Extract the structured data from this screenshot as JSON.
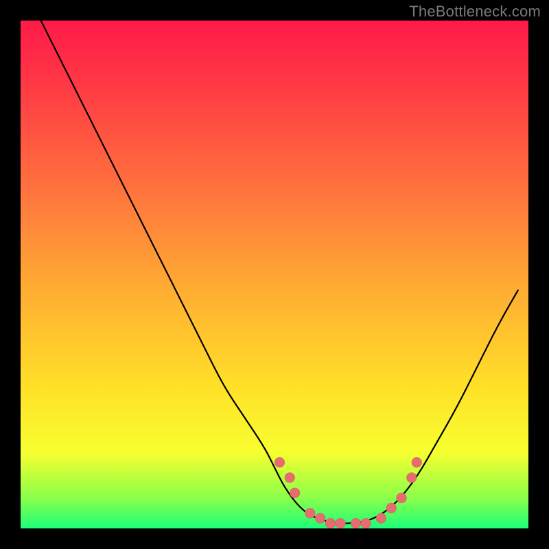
{
  "watermark": "TheBottleneck.com",
  "colors": {
    "frame_bg": "#000000",
    "gradient_top": "#ff1a49",
    "gradient_bottom": "#1cff79",
    "curve": "#000000",
    "marker": "#e86b6f"
  },
  "chart_data": {
    "type": "line",
    "title": "",
    "xlabel": "",
    "ylabel": "",
    "xlim": [
      0,
      100
    ],
    "ylim": [
      0,
      100
    ],
    "grid": false,
    "legend": false,
    "curve": [
      {
        "x": 4,
        "y": 100
      },
      {
        "x": 8,
        "y": 92
      },
      {
        "x": 12,
        "y": 84
      },
      {
        "x": 16,
        "y": 76
      },
      {
        "x": 20,
        "y": 68
      },
      {
        "x": 24,
        "y": 60
      },
      {
        "x": 28,
        "y": 52
      },
      {
        "x": 32,
        "y": 44
      },
      {
        "x": 36,
        "y": 36
      },
      {
        "x": 40,
        "y": 28
      },
      {
        "x": 44,
        "y": 22
      },
      {
        "x": 48,
        "y": 16
      },
      {
        "x": 50,
        "y": 12
      },
      {
        "x": 52,
        "y": 8
      },
      {
        "x": 55,
        "y": 4
      },
      {
        "x": 58,
        "y": 2
      },
      {
        "x": 62,
        "y": 1
      },
      {
        "x": 66,
        "y": 1
      },
      {
        "x": 70,
        "y": 2
      },
      {
        "x": 74,
        "y": 5
      },
      {
        "x": 78,
        "y": 10
      },
      {
        "x": 82,
        "y": 17
      },
      {
        "x": 86,
        "y": 24
      },
      {
        "x": 90,
        "y": 32
      },
      {
        "x": 94,
        "y": 40
      },
      {
        "x": 98,
        "y": 47
      }
    ],
    "markers": [
      {
        "x": 51,
        "y": 13
      },
      {
        "x": 53,
        "y": 10
      },
      {
        "x": 54,
        "y": 7
      },
      {
        "x": 57,
        "y": 3
      },
      {
        "x": 59,
        "y": 2
      },
      {
        "x": 61,
        "y": 1
      },
      {
        "x": 63,
        "y": 1
      },
      {
        "x": 66,
        "y": 1
      },
      {
        "x": 68,
        "y": 1
      },
      {
        "x": 71,
        "y": 2
      },
      {
        "x": 73,
        "y": 4
      },
      {
        "x": 75,
        "y": 6
      },
      {
        "x": 77,
        "y": 10
      },
      {
        "x": 78,
        "y": 13
      }
    ]
  }
}
